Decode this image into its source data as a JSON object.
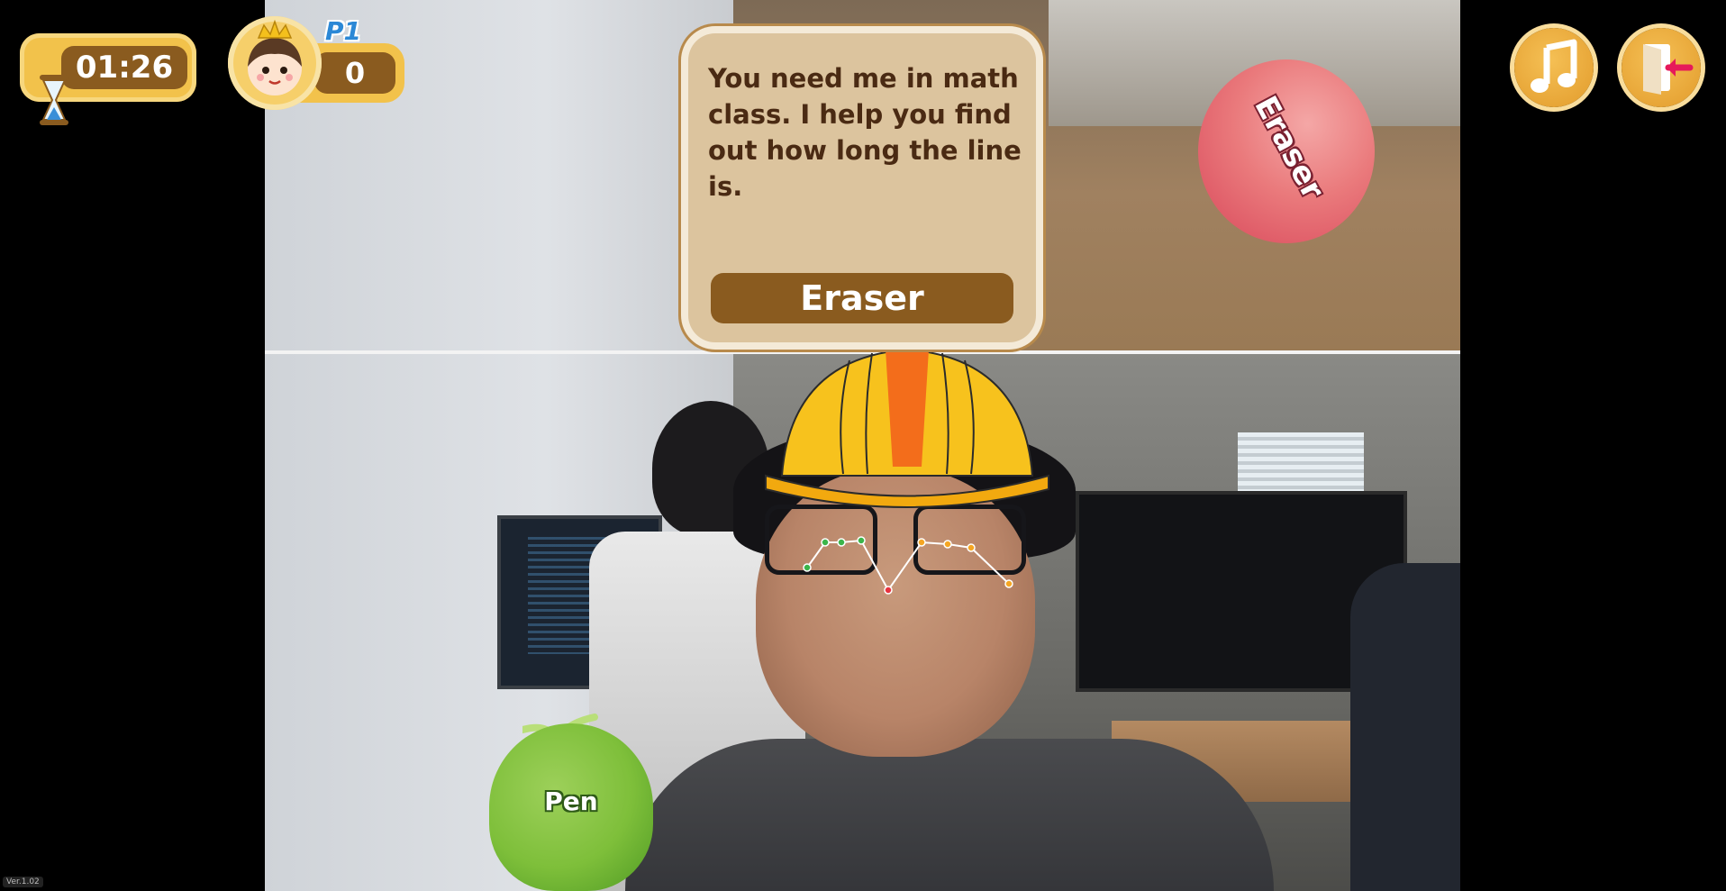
{
  "hud": {
    "timer": "01:26",
    "player_tag": "P1",
    "score": "0"
  },
  "card": {
    "question": "You need me in math class. I help you find out how long the line is.",
    "answer": "Eraser"
  },
  "balls": {
    "eraser_label": "Eraser",
    "pen_label": "Pen"
  },
  "buttons": {
    "music_icon": "music-note-icon",
    "exit_icon": "exit-door-icon"
  },
  "footer": {
    "version": "Ver.1.02"
  },
  "colors": {
    "accent_gold": "#f2c24b",
    "brown": "#8a5b1f",
    "card_bg": "#dcc49e",
    "eraser_pink": "#ea7a7c",
    "pen_green": "#7ebf3a",
    "player_blue": "#2b88d6"
  }
}
